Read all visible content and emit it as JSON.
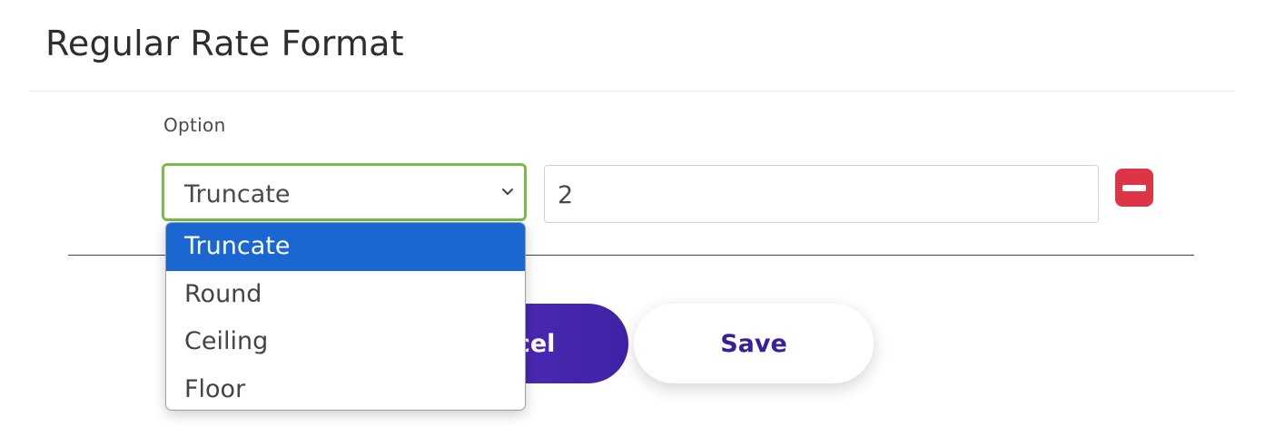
{
  "page": {
    "title": "Regular Rate Format"
  },
  "form": {
    "option_label": "Option",
    "select": {
      "value": "Truncate",
      "options": [
        "Truncate",
        "Round",
        "Ceiling",
        "Floor"
      ],
      "highlighted_index": 0
    },
    "number_value": "2"
  },
  "buttons": {
    "cancel_label": "Cancel",
    "save_label": "Save"
  },
  "colors": {
    "focus_border": "#76bd4b",
    "remove_button": "#dc3545",
    "primary_button": "#4a28b4",
    "dropdown_highlight": "#1a67d2"
  },
  "icons": {
    "select_arrow": "chevron-down-icon",
    "remove": "minus-icon"
  }
}
